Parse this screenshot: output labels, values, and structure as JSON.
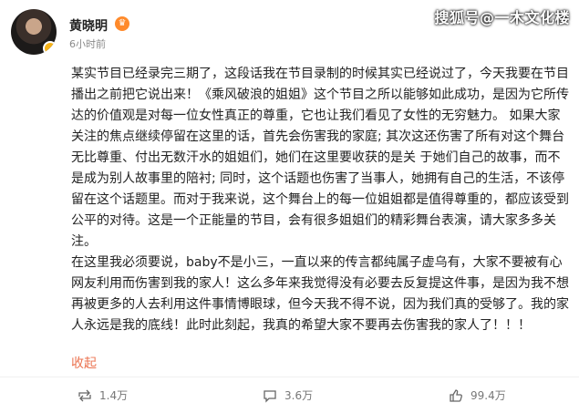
{
  "user": {
    "name": "黄晓明",
    "time": "6小时前"
  },
  "watermark": "搜狐号@一木文化楼",
  "post": {
    "paragraph1": "某实节目已经录完三期了，这段话我在节目录制的时候其实已经说过了，今天我要在节目播出之前把它说出来！《乘风破浪的姐姐》这个节目之所以能够如此成功，是因为它所传达的价值观是对每一位女性真正的尊重，它也让我们看见了女性的无穷魅力。 如果大家关注的焦点继续停留在这里的话，首先会伤害我的家庭; 其次这还伤害了所有对这个舞台无比尊重、付出无数汗水的姐姐们，她们在这里要收获的是关 于她们自己的故事，而不是成为别人故事里的陪衬; 同时，这个话题也伤害了当事人，她拥有自己的生活，不该停留在这个话题里。而对于我来说，这个舞台上的每一位姐姐都是值得尊重的，都应该受到公平的对待。这是一个正能量的节目，会有很多姐姐们的精彩舞台表演，请大家多多关注。",
    "paragraph2": "在这里我必须要说，baby不是小三，一直以来的传言都纯属子虚乌有，大家不要被有心网友利用而伤害到我的家人！这么多年来我觉得没有必要去反复提这件事，是因为我不想再被更多的人去利用这件事情博眼球，但今天我不得不说，因为我们真的受够了。我的家人永远是我的底线！此时此刻起，我真的希望大家不要再去伤害我的家人了！！！",
    "collapse_label": "收起"
  },
  "actions": {
    "repost": "1.4万",
    "comment": "3.6万",
    "like": "99.4万"
  },
  "colors": {
    "accent": "#eb7350",
    "vip": "#ff8a2b"
  },
  "icons": [
    "verified-badge-icon",
    "vip-icon",
    "repost-icon",
    "comment-icon",
    "like-icon"
  ]
}
